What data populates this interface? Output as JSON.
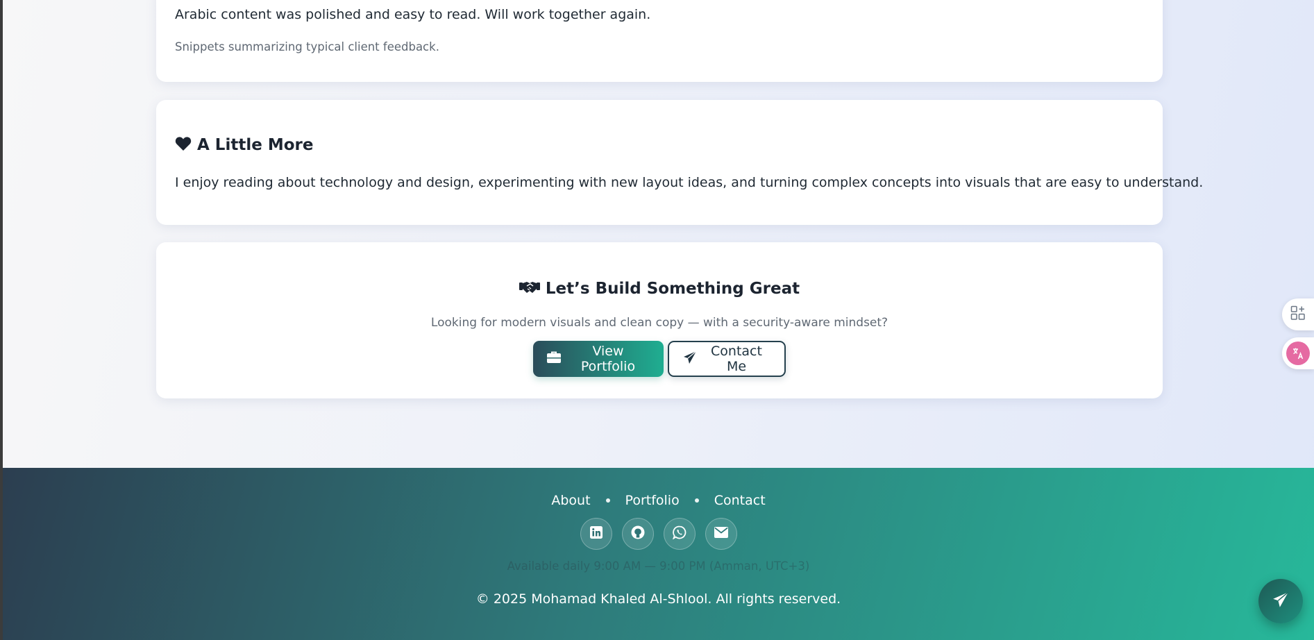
{
  "feedback": {
    "text": "Arabic content was polished and easy to read. Will work together again.",
    "caption": "Snippets summarizing typical client feedback."
  },
  "more": {
    "icon": "heart-icon",
    "title": "A Little More",
    "text": "I enjoy reading about technology and design, experimenting with new layout ideas, and turning complex concepts into visuals that are easy to understand."
  },
  "cta": {
    "icon": "handshake-icon",
    "title": "Let’s Build Something Great",
    "subtitle": "Looking for modern visuals and clean copy — with a security-aware mindset?",
    "primary_button": {
      "icon": "briefcase-icon",
      "label": "View Portfolio"
    },
    "secondary_button": {
      "icon": "paper-plane-icon",
      "label": "Contact Me"
    }
  },
  "footer": {
    "nav": [
      "About",
      "Portfolio",
      "Contact"
    ],
    "socials": [
      "linkedin-icon",
      "github-icon",
      "whatsapp-icon",
      "envelope-icon"
    ],
    "availability": "Available daily 9:00 AM — 9:00 PM (Amman, UTC+3)",
    "copyright": "© 2025 Mohamad Khaled Al-Shlool. All rights reserved."
  },
  "colors": {
    "accent_start": "#2b4d5a",
    "accent_end": "#1fae91",
    "footer_start": "#2c3e50",
    "footer_end": "#27b89a",
    "translate_badge": "#e56aa2"
  }
}
